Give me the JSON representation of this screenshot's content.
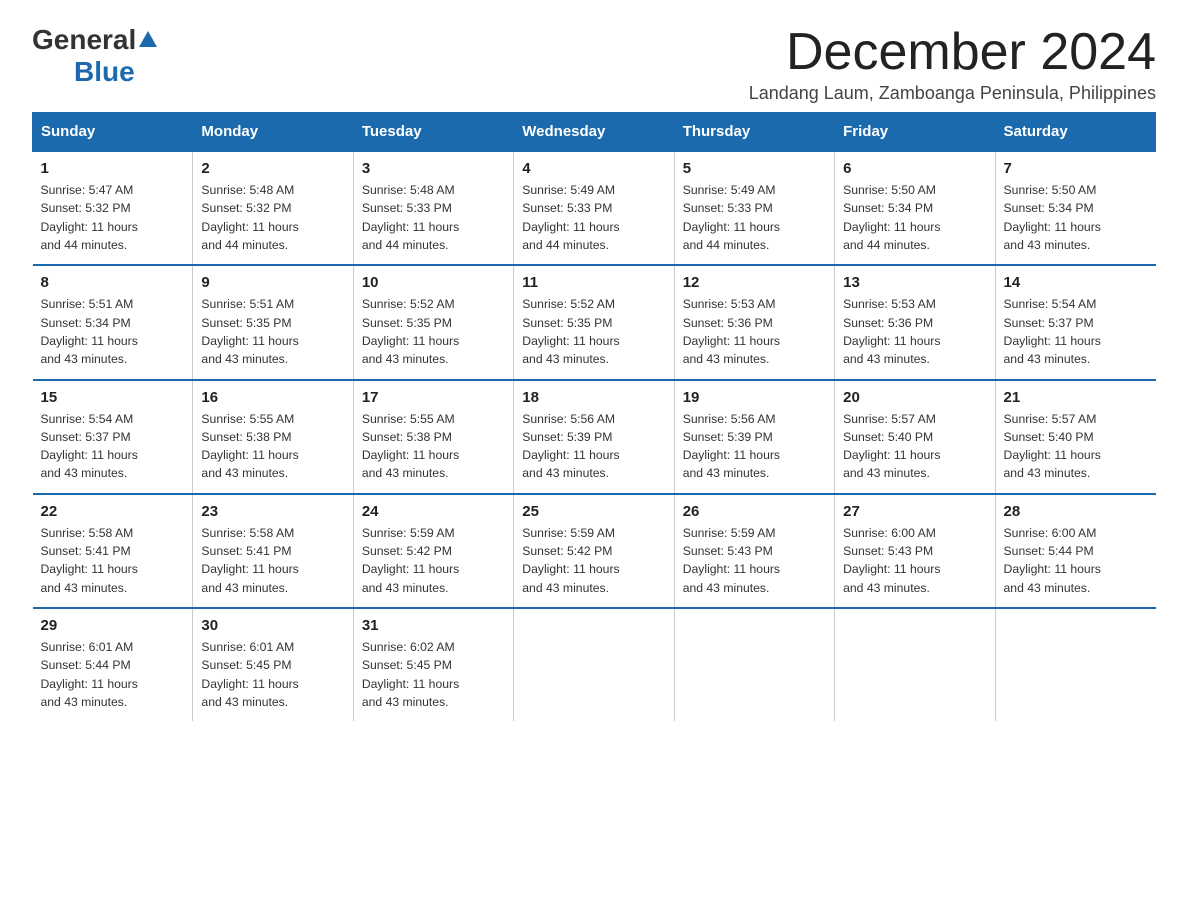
{
  "logo": {
    "general": "General",
    "blue": "Blue"
  },
  "title": "December 2024",
  "subtitle": "Landang Laum, Zamboanga Peninsula, Philippines",
  "days_header": [
    "Sunday",
    "Monday",
    "Tuesday",
    "Wednesday",
    "Thursday",
    "Friday",
    "Saturday"
  ],
  "weeks": [
    [
      {
        "day": "1",
        "sunrise": "5:47 AM",
        "sunset": "5:32 PM",
        "daylight": "11 hours and 44 minutes."
      },
      {
        "day": "2",
        "sunrise": "5:48 AM",
        "sunset": "5:32 PM",
        "daylight": "11 hours and 44 minutes."
      },
      {
        "day": "3",
        "sunrise": "5:48 AM",
        "sunset": "5:33 PM",
        "daylight": "11 hours and 44 minutes."
      },
      {
        "day": "4",
        "sunrise": "5:49 AM",
        "sunset": "5:33 PM",
        "daylight": "11 hours and 44 minutes."
      },
      {
        "day": "5",
        "sunrise": "5:49 AM",
        "sunset": "5:33 PM",
        "daylight": "11 hours and 44 minutes."
      },
      {
        "day": "6",
        "sunrise": "5:50 AM",
        "sunset": "5:34 PM",
        "daylight": "11 hours and 44 minutes."
      },
      {
        "day": "7",
        "sunrise": "5:50 AM",
        "sunset": "5:34 PM",
        "daylight": "11 hours and 43 minutes."
      }
    ],
    [
      {
        "day": "8",
        "sunrise": "5:51 AM",
        "sunset": "5:34 PM",
        "daylight": "11 hours and 43 minutes."
      },
      {
        "day": "9",
        "sunrise": "5:51 AM",
        "sunset": "5:35 PM",
        "daylight": "11 hours and 43 minutes."
      },
      {
        "day": "10",
        "sunrise": "5:52 AM",
        "sunset": "5:35 PM",
        "daylight": "11 hours and 43 minutes."
      },
      {
        "day": "11",
        "sunrise": "5:52 AM",
        "sunset": "5:35 PM",
        "daylight": "11 hours and 43 minutes."
      },
      {
        "day": "12",
        "sunrise": "5:53 AM",
        "sunset": "5:36 PM",
        "daylight": "11 hours and 43 minutes."
      },
      {
        "day": "13",
        "sunrise": "5:53 AM",
        "sunset": "5:36 PM",
        "daylight": "11 hours and 43 minutes."
      },
      {
        "day": "14",
        "sunrise": "5:54 AM",
        "sunset": "5:37 PM",
        "daylight": "11 hours and 43 minutes."
      }
    ],
    [
      {
        "day": "15",
        "sunrise": "5:54 AM",
        "sunset": "5:37 PM",
        "daylight": "11 hours and 43 minutes."
      },
      {
        "day": "16",
        "sunrise": "5:55 AM",
        "sunset": "5:38 PM",
        "daylight": "11 hours and 43 minutes."
      },
      {
        "day": "17",
        "sunrise": "5:55 AM",
        "sunset": "5:38 PM",
        "daylight": "11 hours and 43 minutes."
      },
      {
        "day": "18",
        "sunrise": "5:56 AM",
        "sunset": "5:39 PM",
        "daylight": "11 hours and 43 minutes."
      },
      {
        "day": "19",
        "sunrise": "5:56 AM",
        "sunset": "5:39 PM",
        "daylight": "11 hours and 43 minutes."
      },
      {
        "day": "20",
        "sunrise": "5:57 AM",
        "sunset": "5:40 PM",
        "daylight": "11 hours and 43 minutes."
      },
      {
        "day": "21",
        "sunrise": "5:57 AM",
        "sunset": "5:40 PM",
        "daylight": "11 hours and 43 minutes."
      }
    ],
    [
      {
        "day": "22",
        "sunrise": "5:58 AM",
        "sunset": "5:41 PM",
        "daylight": "11 hours and 43 minutes."
      },
      {
        "day": "23",
        "sunrise": "5:58 AM",
        "sunset": "5:41 PM",
        "daylight": "11 hours and 43 minutes."
      },
      {
        "day": "24",
        "sunrise": "5:59 AM",
        "sunset": "5:42 PM",
        "daylight": "11 hours and 43 minutes."
      },
      {
        "day": "25",
        "sunrise": "5:59 AM",
        "sunset": "5:42 PM",
        "daylight": "11 hours and 43 minutes."
      },
      {
        "day": "26",
        "sunrise": "5:59 AM",
        "sunset": "5:43 PM",
        "daylight": "11 hours and 43 minutes."
      },
      {
        "day": "27",
        "sunrise": "6:00 AM",
        "sunset": "5:43 PM",
        "daylight": "11 hours and 43 minutes."
      },
      {
        "day": "28",
        "sunrise": "6:00 AM",
        "sunset": "5:44 PM",
        "daylight": "11 hours and 43 minutes."
      }
    ],
    [
      {
        "day": "29",
        "sunrise": "6:01 AM",
        "sunset": "5:44 PM",
        "daylight": "11 hours and 43 minutes."
      },
      {
        "day": "30",
        "sunrise": "6:01 AM",
        "sunset": "5:45 PM",
        "daylight": "11 hours and 43 minutes."
      },
      {
        "day": "31",
        "sunrise": "6:02 AM",
        "sunset": "5:45 PM",
        "daylight": "11 hours and 43 minutes."
      },
      null,
      null,
      null,
      null
    ]
  ],
  "labels": {
    "sunrise": "Sunrise:",
    "sunset": "Sunset:",
    "daylight": "Daylight:"
  }
}
